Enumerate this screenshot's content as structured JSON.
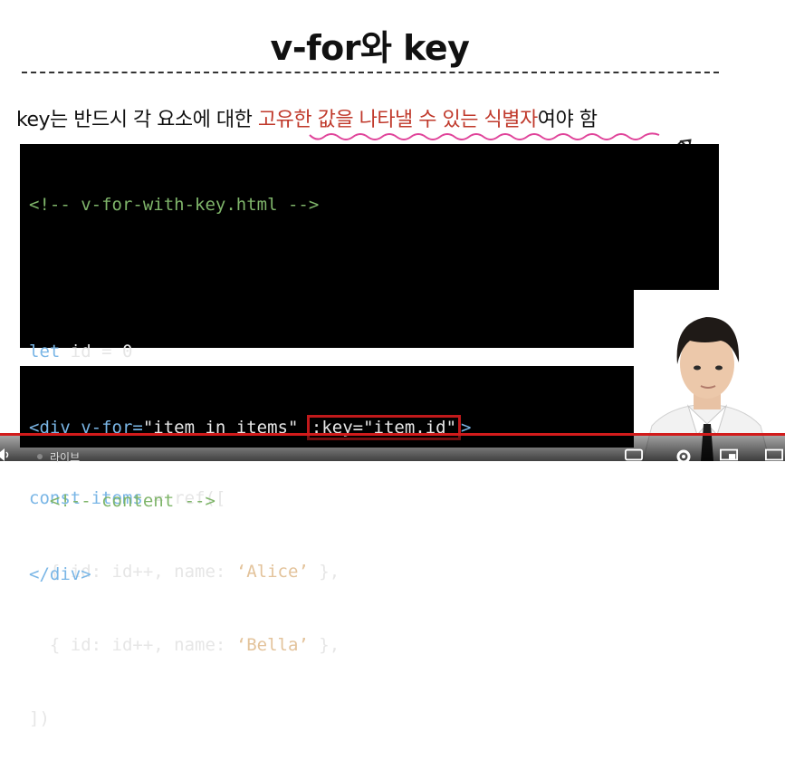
{
  "slide": {
    "title": "v-for와 key",
    "subtitle_prefix": "key는 반드시 각 요소에 대한 ",
    "subtitle_highlight": "고유한 값을 나타낼 수 있는 식별자",
    "subtitle_suffix": "여야 함"
  },
  "code1": {
    "comment": "<!-- v-for-with-key.html -->",
    "let_kw": "let",
    "let_rest": " id = 0",
    "const_kw": "const",
    "const_var": " items",
    "const_rest": " = ref([",
    "item1_pre": "  { id: id++, name: ",
    "item1_str": "‘Alice’",
    "item1_post": " },",
    "item2_pre": "  { id: id++, name: ",
    "item2_str": "‘Bella’",
    "item2_post": " },",
    "close": "])"
  },
  "code2": {
    "open_tag": "<div",
    "vfor_attr": " v-for=",
    "vfor_val": "\"item in items\"",
    "space": " ",
    "key_attr": ":key=",
    "key_val": "\"item.id\"",
    "open_end": ">",
    "comment": "  <!-- content -->",
    "close_tag": "</div>"
  },
  "player": {
    "live_label": "라이브",
    "progress": 1.0,
    "accent": "#d21b1b"
  },
  "colors": {
    "highlight": "#c0392b",
    "key_box": "#c0191b",
    "code_bg": "#000000"
  }
}
